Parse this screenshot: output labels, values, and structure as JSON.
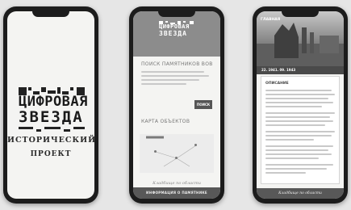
{
  "phone1": {
    "logo_line1": "ЦИФРОВАЯ",
    "logo_line2": "ЗВЕЗДА",
    "subtitle_line1": "ИСТОРИЧЕСКИЙ",
    "subtitle_line2": "ПРОЕКТ"
  },
  "phone2": {
    "logo_line1": "ЦИФРОВАЯ",
    "logo_line2": "ЗВЕЗДА",
    "search_title": "ПОИСК ПАМЯТНИКОВ ВОВ",
    "search_button": "ПОИСК",
    "map_title": "КАРТА ОБЪЕКТОВ",
    "footer_signature": "Кладбище по области",
    "bottom_bar": "ИНФОРМАЦИЯ О ПАМЯТНИКЕ"
  },
  "phone3": {
    "top_label": "ГЛАВНАЯ",
    "photo_caption": "22. 1941. 09. 1943",
    "card_title": "ОПИСАНИЕ",
    "bottom_bar": "Кладбище по области"
  }
}
